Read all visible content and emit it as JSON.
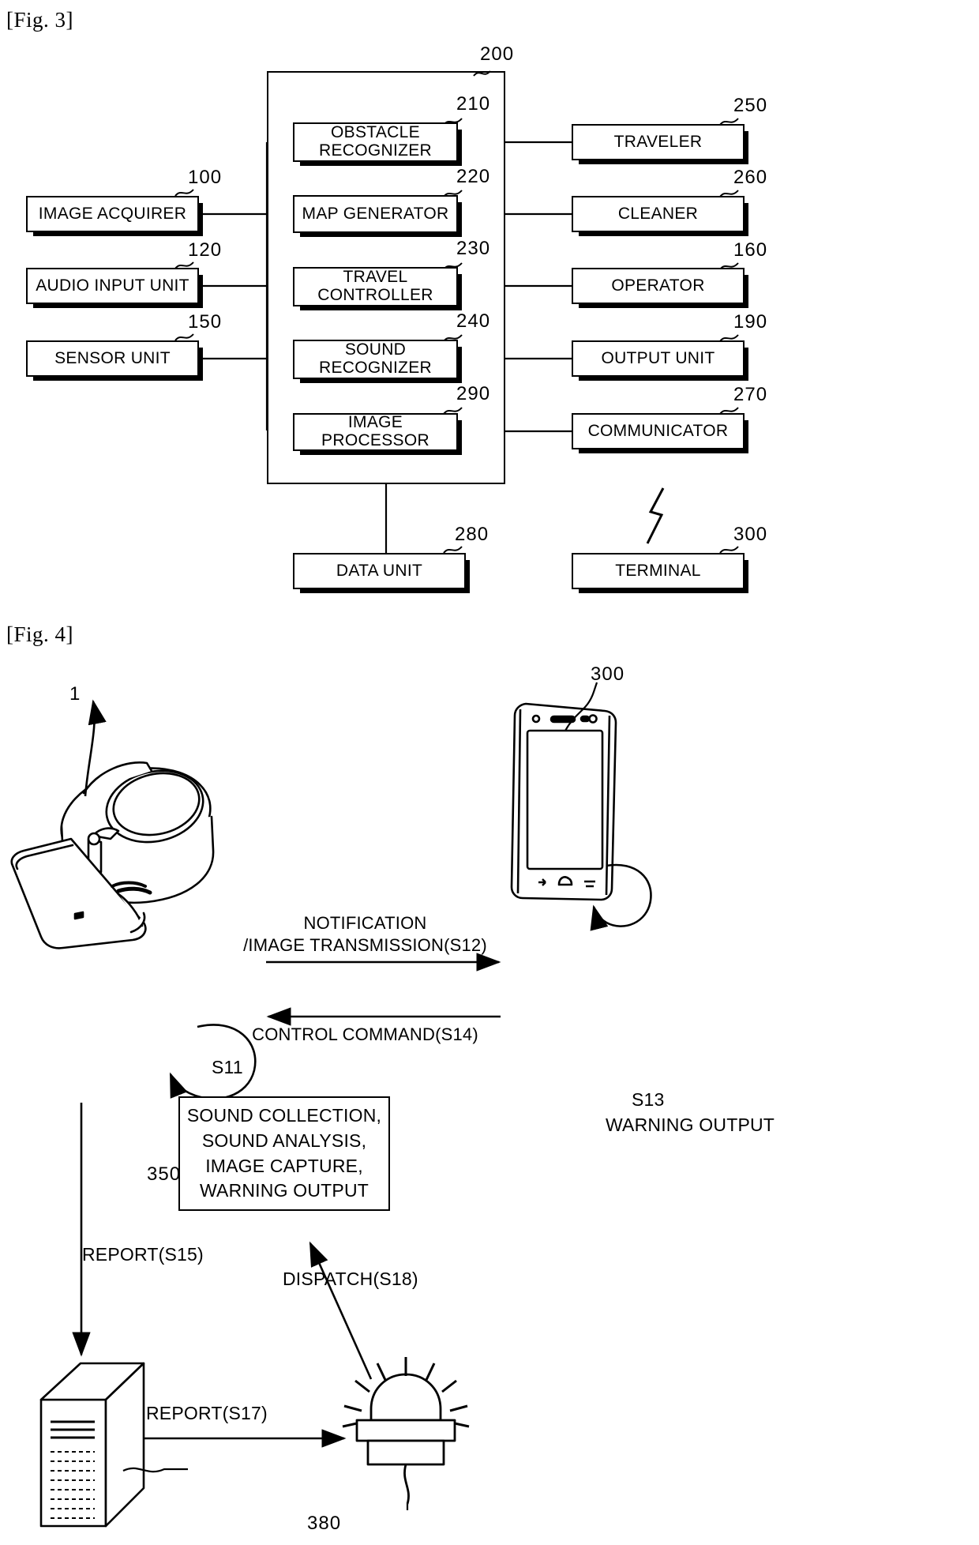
{
  "figures": {
    "fig3": {
      "caption": "[Fig. 3]",
      "controller": {
        "ref": "200"
      },
      "inner_modules": [
        {
          "label": "OBSTACLE\nRECOGNIZER",
          "ref": "210"
        },
        {
          "label": "MAP GENERATOR",
          "ref": "220"
        },
        {
          "label": "TRAVEL\nCONTROLLER",
          "ref": "230"
        },
        {
          "label": "SOUND\nRECOGNIZER",
          "ref": "240"
        },
        {
          "label": "IMAGE PROCESSOR",
          "ref": "290"
        }
      ],
      "left_modules": [
        {
          "label": "IMAGE ACQUIRER",
          "ref": "100"
        },
        {
          "label": "AUDIO INPUT UNIT",
          "ref": "120"
        },
        {
          "label": "SENSOR UNIT",
          "ref": "150"
        }
      ],
      "right_modules": [
        {
          "label": "TRAVELER",
          "ref": "250"
        },
        {
          "label": "CLEANER",
          "ref": "260"
        },
        {
          "label": "OPERATOR",
          "ref": "160"
        },
        {
          "label": "OUTPUT UNIT",
          "ref": "190"
        },
        {
          "label": "COMMUNICATOR",
          "ref": "270"
        }
      ],
      "bottom_modules": [
        {
          "label": "DATA UNIT",
          "ref": "280"
        },
        {
          "label": "TERMINAL",
          "ref": "300"
        }
      ]
    },
    "fig4": {
      "caption": "[Fig. 4]",
      "robot_ref": "1",
      "terminal_ref": "300",
      "server_ref": "350",
      "siren_ref": "380",
      "flows": [
        {
          "id": "s12",
          "label": "NOTIFICATION\n/IMAGE TRANSMISSION(S12)"
        },
        {
          "id": "s14",
          "label": "CONTROL COMMAND(S14)"
        },
        {
          "id": "s11",
          "label": "S11"
        },
        {
          "id": "s13",
          "label": "S13"
        },
        {
          "id": "s13warn",
          "label": "WARNING OUTPUT"
        },
        {
          "id": "s15",
          "label": "REPORT(S15)"
        },
        {
          "id": "s17",
          "label": "REPORT(S17)"
        },
        {
          "id": "s18",
          "label": "DISPATCH(S18)"
        }
      ],
      "action_box": "SOUND COLLECTION,\nSOUND ANALYSIS,\nIMAGE CAPTURE,\nWARNING OUTPUT"
    }
  },
  "colors": {
    "ink": "#000000",
    "paper": "#ffffff"
  }
}
